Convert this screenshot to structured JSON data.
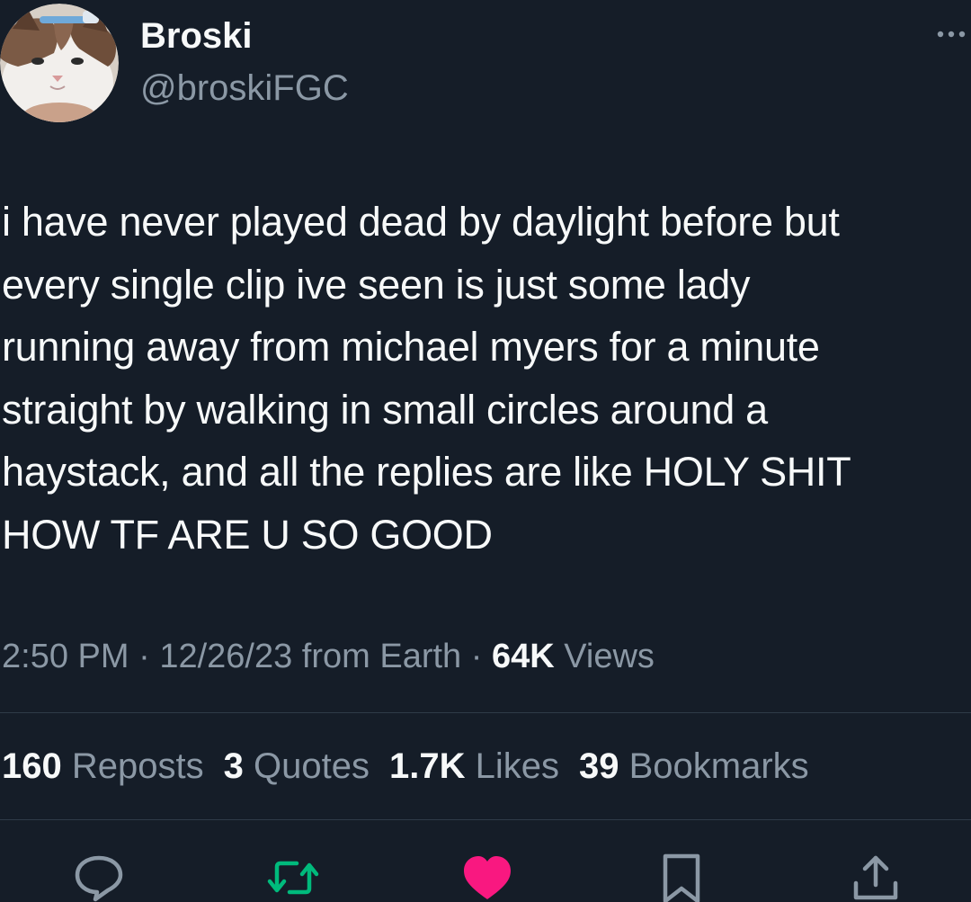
{
  "author": {
    "display_name": "Broski",
    "handle": "@broskiFGC",
    "avatar": "cat-avatar"
  },
  "menu_icon": "more-options-icon",
  "tweet": {
    "text": "i have never played dead by daylight before but\nevery single clip ive seen is just some lady\nrunning away from michael myers for a minute\nstraight by walking in small circles around a\nhaystack, and all the replies are like HOLY SHIT\nHOW TF ARE U SO GOOD"
  },
  "meta": {
    "time": "2:50 PM",
    "sep1": " · ",
    "date": "12/26/23",
    "source": " from Earth",
    "sep2": " · ",
    "views_count": "64K",
    "views_label": " Views"
  },
  "stats": {
    "reposts_count": "160",
    "reposts_label": "Reposts",
    "quotes_count": "3",
    "quotes_label": "Quotes",
    "likes_count": "1.7K",
    "likes_label": "Likes",
    "bookmarks_count": "39",
    "bookmarks_label": "Bookmarks"
  },
  "actions": [
    {
      "name": "reply",
      "icon": "reply-bubble-icon",
      "color": "#8b98a5"
    },
    {
      "name": "repost",
      "icon": "repost-icon",
      "color": "#00ba7c"
    },
    {
      "name": "like",
      "icon": "heart-icon",
      "color": "#f91880",
      "active": true
    },
    {
      "name": "bookmark",
      "icon": "bookmark-icon",
      "color": "#8b98a5"
    },
    {
      "name": "share",
      "icon": "share-icon",
      "color": "#8b98a5"
    }
  ],
  "colors": {
    "background": "#151d28",
    "text_primary": "#f7f9f9",
    "text_secondary": "#8b98a5",
    "repost_green": "#00ba7c",
    "like_pink": "#f91880"
  }
}
